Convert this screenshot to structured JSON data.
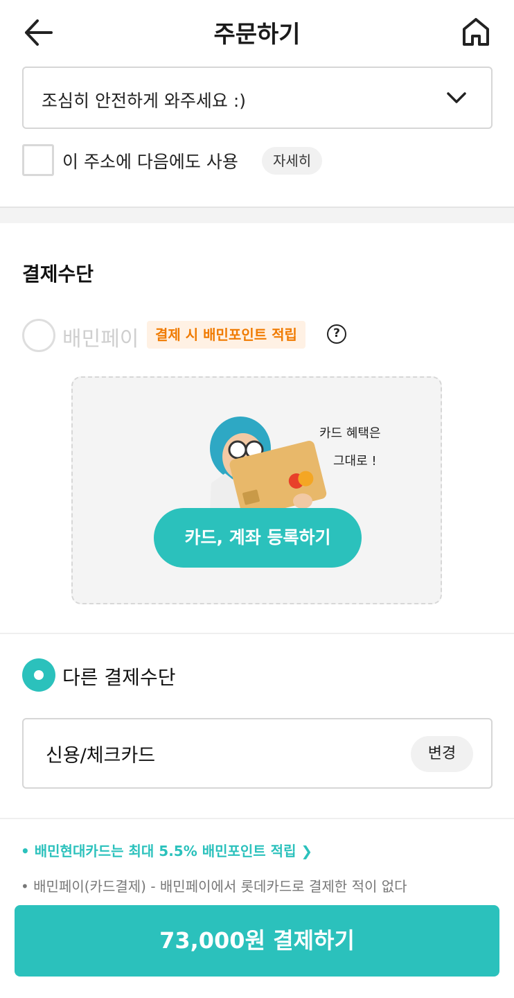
{
  "header": {
    "title": "주문하기",
    "back_icon": "back-arrow-icon",
    "home_icon": "home-icon"
  },
  "request": {
    "selected": "조심히 안전하게 와주세요 :)"
  },
  "save_address": {
    "label": "이 주소에 다음에도 사용",
    "detail_label": "자세히",
    "checked": false
  },
  "payment": {
    "section_title": "결제수단",
    "baemin_pay": {
      "label": "배민페이",
      "badge": "결제 시 배민포인트 적립",
      "register_button": "카드, 계좌 등록하기",
      "illustration_text_line1": "카드 혜택은",
      "illustration_text_line2": "그대로 !"
    },
    "other": {
      "label": "다른 결제수단",
      "method": "신용/체크카드",
      "change_label": "변경"
    },
    "promo": "• 배민현대카드는 최대 5.5% 배민포인트 적립 ❯",
    "note": "• 배민페이(카드결제) - 배민페이에서 롯데카드로 결제한 적이 없다"
  },
  "pay_button": {
    "label": "73,000원 결제하기"
  },
  "colors": {
    "accent": "#2bc1bc",
    "badge_text": "#f07a00",
    "badge_bg": "#fff1e4"
  }
}
